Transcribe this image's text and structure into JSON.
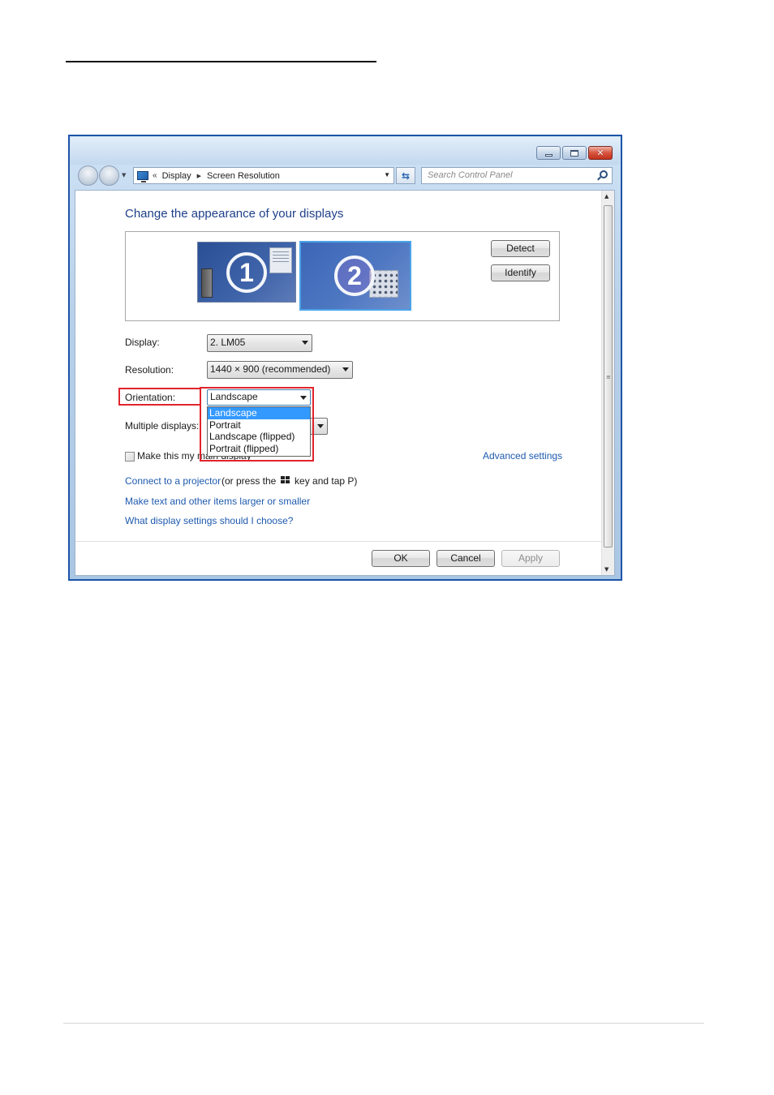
{
  "window": {
    "breadcrumb": [
      "Display",
      "Screen Resolution"
    ],
    "search_placeholder": "Search Control Panel"
  },
  "content": {
    "heading": "Change the appearance of your displays",
    "monitors": [
      {
        "number": "1"
      },
      {
        "number": "2"
      }
    ],
    "detect_label": "Detect",
    "identify_label": "Identify",
    "display_label": "Display:",
    "display_value": "2. LM05",
    "resolution_label": "Resolution:",
    "resolution_value": "1440 × 900 (recommended)",
    "orientation_label": "Orientation:",
    "orientation_value": "Landscape",
    "orientation_options": [
      "Landscape",
      "Portrait",
      "Landscape (flipped)",
      "Portrait (flipped)"
    ],
    "multiple_displays_label": "Multiple displays:",
    "main_display_label": "Make this my main display",
    "advanced_settings": "Advanced settings",
    "projector_link": "Connect to a projector",
    "projector_text_before": "(or press the",
    "projector_text_after": "key and tap P)",
    "text_size_link": "Make text and other items larger or smaller",
    "help_link": "What display settings should I choose?"
  },
  "footer": {
    "ok": "OK",
    "cancel": "Cancel",
    "apply": "Apply"
  },
  "colors": {
    "accent_link": "#1e5aae",
    "selection": "#3399ff",
    "highlight": "#e0242c"
  }
}
